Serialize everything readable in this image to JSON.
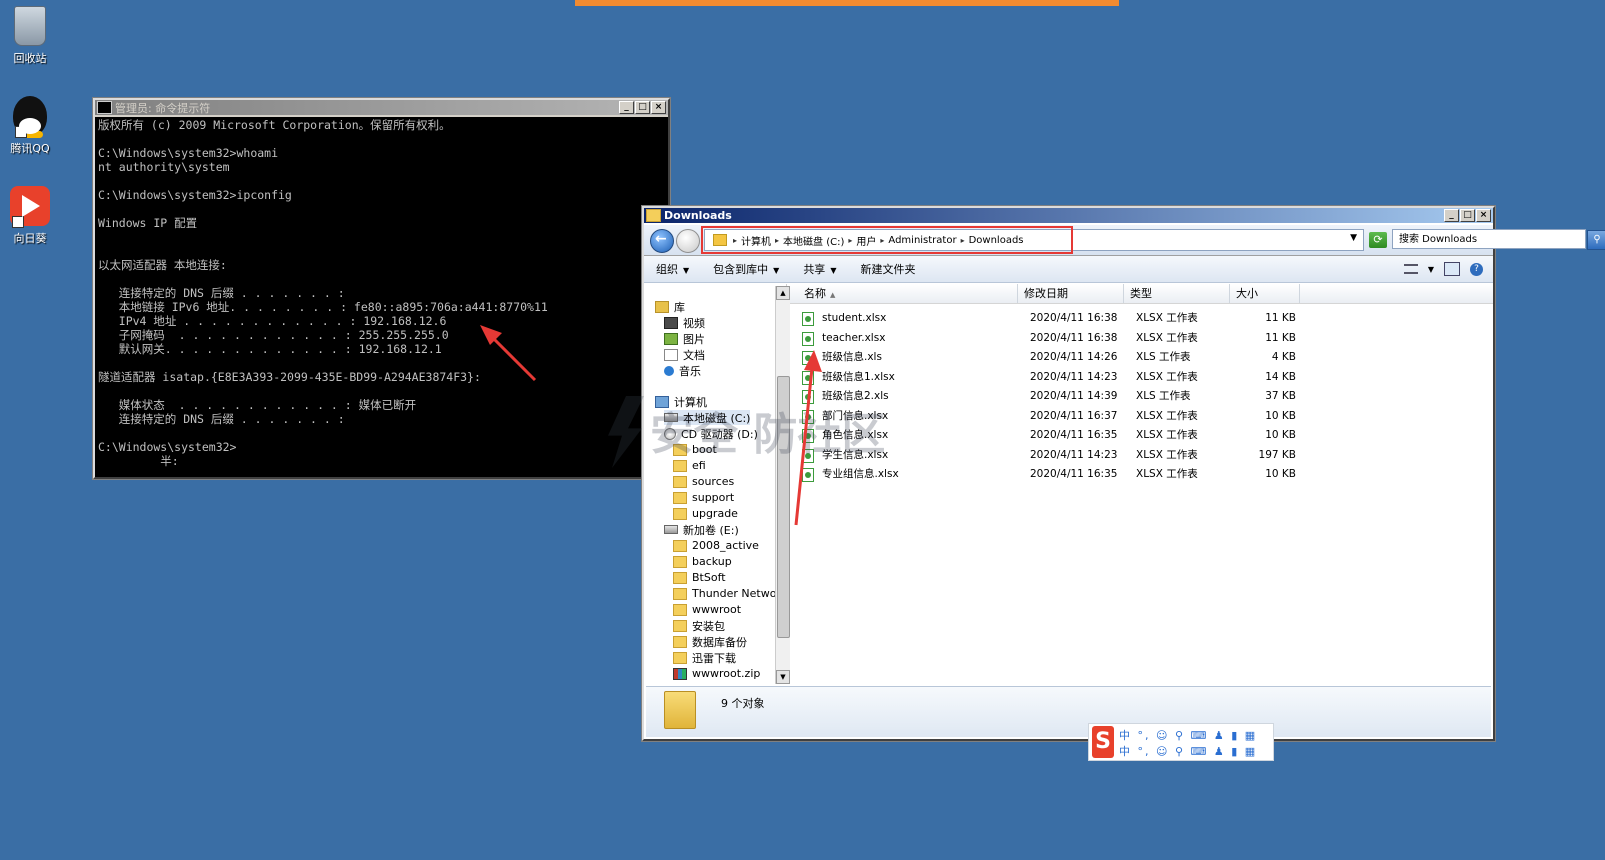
{
  "desktop": {
    "icons": [
      {
        "label": "回收站",
        "icon": "recycle-bin-icon"
      },
      {
        "label": "腾讯QQ",
        "icon": "qq-penguin-icon"
      },
      {
        "label": "向日葵",
        "icon": "sunlogin-icon"
      }
    ]
  },
  "cmd": {
    "title": "管理员: 命令提示符",
    "lines": [
      "版权所有 (c) 2009 Microsoft Corporation。保留所有权利。",
      "",
      "C:\\Windows\\system32>whoami",
      "nt authority\\system",
      "",
      "C:\\Windows\\system32>ipconfig",
      "",
      "Windows IP 配置",
      "",
      "",
      "以太网适配器 本地连接:",
      "",
      "   连接特定的 DNS 后缀 . . . . . . . :",
      "   本地链接 IPv6 地址. . . . . . . . : fe80::a895:706a:a441:8770%11",
      "   IPv4 地址 . . . . . . . . . . . . : 192.168.12.6",
      "   子网掩码  . . . . . . . . . . . . : 255.255.255.0",
      "   默认网关. . . . . . . . . . . . . : 192.168.12.1",
      "",
      "隧道适配器 isatap.{E8E3A393-2099-435E-BD99-A294AE3874F3}:",
      "",
      "   媒体状态  . . . . . . . . . . . . : 媒体已断开",
      "   连接特定的 DNS 后缀 . . . . . . . :",
      "",
      "C:\\Windows\\system32>",
      "         半:"
    ]
  },
  "explorer": {
    "title": "Downloads",
    "breadcrumb": [
      "计算机",
      "本地磁盘 (C:)",
      "用户",
      "Administrator",
      "Downloads"
    ],
    "search_placeholder": "搜索 Downloads",
    "toolbar": {
      "organize": "组织",
      "include_library": "包含到库中",
      "share": "共享",
      "new_folder": "新建文件夹"
    },
    "tree": [
      {
        "label": "库",
        "icon": "library-icon",
        "indent": 1
      },
      {
        "label": "视频",
        "icon": "video-icon",
        "indent": 2
      },
      {
        "label": "图片",
        "icon": "picture-icon",
        "indent": 2
      },
      {
        "label": "文档",
        "icon": "document-icon",
        "indent": 2
      },
      {
        "label": "音乐",
        "icon": "music-icon",
        "indent": 2
      },
      {
        "label": "",
        "icon": "",
        "indent": 0
      },
      {
        "label": "计算机",
        "icon": "computer-icon",
        "indent": 1
      },
      {
        "label": "本地磁盘 (C:)",
        "icon": "drive-icon",
        "indent": 2,
        "selected": true
      },
      {
        "label": "CD 驱动器 (D:)",
        "icon": "cd-drive-icon",
        "indent": 2
      },
      {
        "label": "boot",
        "icon": "folder-icon",
        "indent": 3
      },
      {
        "label": "efi",
        "icon": "folder-icon",
        "indent": 3
      },
      {
        "label": "sources",
        "icon": "folder-icon",
        "indent": 3
      },
      {
        "label": "support",
        "icon": "folder-icon",
        "indent": 3
      },
      {
        "label": "upgrade",
        "icon": "folder-icon",
        "indent": 3
      },
      {
        "label": "新加卷 (E:)",
        "icon": "drive-icon",
        "indent": 2
      },
      {
        "label": "2008_active",
        "icon": "folder-icon",
        "indent": 3
      },
      {
        "label": "backup",
        "icon": "folder-icon",
        "indent": 3
      },
      {
        "label": "BtSoft",
        "icon": "folder-icon",
        "indent": 3
      },
      {
        "label": "Thunder Networ",
        "icon": "folder-icon",
        "indent": 3
      },
      {
        "label": "wwwroot",
        "icon": "folder-icon",
        "indent": 3
      },
      {
        "label": "安装包",
        "icon": "folder-icon",
        "indent": 3
      },
      {
        "label": "数据库备份",
        "icon": "folder-icon",
        "indent": 3
      },
      {
        "label": "迅雷下载",
        "icon": "folder-icon",
        "indent": 3
      },
      {
        "label": "wwwroot.zip",
        "icon": "zip-icon",
        "indent": 3
      }
    ],
    "columns": [
      "名称",
      "修改日期",
      "类型",
      "大小"
    ],
    "files": [
      {
        "name": "student.xlsx",
        "date": "2020/4/11 16:38",
        "type": "XLSX 工作表",
        "size": "11 KB"
      },
      {
        "name": "teacher.xlsx",
        "date": "2020/4/11 16:38",
        "type": "XLSX 工作表",
        "size": "11 KB"
      },
      {
        "name": "班级信息.xls",
        "date": "2020/4/11 14:26",
        "type": "XLS 工作表",
        "size": "4 KB"
      },
      {
        "name": "班级信息1.xlsx",
        "date": "2020/4/11 14:23",
        "type": "XLSX 工作表",
        "size": "14 KB"
      },
      {
        "name": "班级信息2.xls",
        "date": "2020/4/11 14:39",
        "type": "XLS 工作表",
        "size": "37 KB"
      },
      {
        "name": "部门信息.xlsx",
        "date": "2020/4/11 16:37",
        "type": "XLSX 工作表",
        "size": "10 KB"
      },
      {
        "name": "角色信息.xlsx",
        "date": "2020/4/11 16:35",
        "type": "XLSX 工作表",
        "size": "10 KB"
      },
      {
        "name": "学生信息.xlsx",
        "date": "2020/4/11 14:23",
        "type": "XLSX 工作表",
        "size": "197 KB"
      },
      {
        "name": "专业组信息.xlsx",
        "date": "2020/4/11 16:35",
        "type": "XLSX 工作表",
        "size": "10 KB"
      }
    ],
    "status": "9 个对象"
  },
  "ime": {
    "logo": "S",
    "row1": "中 °, ☺ ⚲ ⌨ ♟ ▮ ▦",
    "row2": "中 °, ☺ ⚲ ⌨ ♟ ▮ ▦"
  },
  "watermark": "安全 防社区",
  "colors": {
    "desktop": "#3a6ea5",
    "highlight": "#e53935",
    "topbar": "#f28b30"
  }
}
